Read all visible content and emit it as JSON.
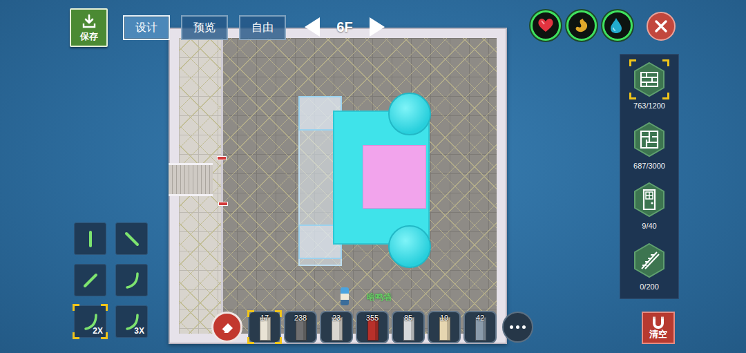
{
  "save_button": {
    "label": "保存"
  },
  "tabs": [
    {
      "label": "设计",
      "selected": true
    },
    {
      "label": "预览",
      "selected": false
    },
    {
      "label": "自由",
      "selected": false
    }
  ],
  "floor": {
    "label": "6F"
  },
  "status_icons": [
    {
      "kind": "heart"
    },
    {
      "kind": "stomach"
    },
    {
      "kind": "drop"
    }
  ],
  "resources": [
    {
      "kind": "wall",
      "count": "763/1200",
      "selected": true
    },
    {
      "kind": "floor",
      "count": "687/3000",
      "selected": false
    },
    {
      "kind": "door",
      "count": "9/40",
      "selected": false
    },
    {
      "kind": "stairs",
      "count": "0/200",
      "selected": false
    }
  ],
  "tools": [
    {
      "kind": "line-vertical",
      "selected": false
    },
    {
      "kind": "line-falling",
      "selected": false
    },
    {
      "kind": "line-rising",
      "selected": false
    },
    {
      "kind": "arc",
      "selected": false
    },
    {
      "kind": "arc",
      "label": "2X",
      "selected": true
    },
    {
      "kind": "arc",
      "label": "3X",
      "selected": false
    }
  ],
  "hotbar": {
    "hint": "暗鸣墙",
    "items": [
      {
        "count": "17",
        "selected": true,
        "color": "#e9e3d5"
      },
      {
        "count": "238",
        "selected": false,
        "color": "#6f6f70"
      },
      {
        "count": "23",
        "selected": false,
        "color": "#d9d6d0"
      },
      {
        "count": "355",
        "selected": false,
        "color": "#b8302a"
      },
      {
        "count": "85",
        "selected": false,
        "color": "#d6d8da"
      },
      {
        "count": "19",
        "selected": false,
        "color": "#e6d6b0"
      },
      {
        "count": "42",
        "selected": false,
        "color": "#8a9bab"
      }
    ]
  },
  "clear_button": {
    "label": "清空"
  }
}
